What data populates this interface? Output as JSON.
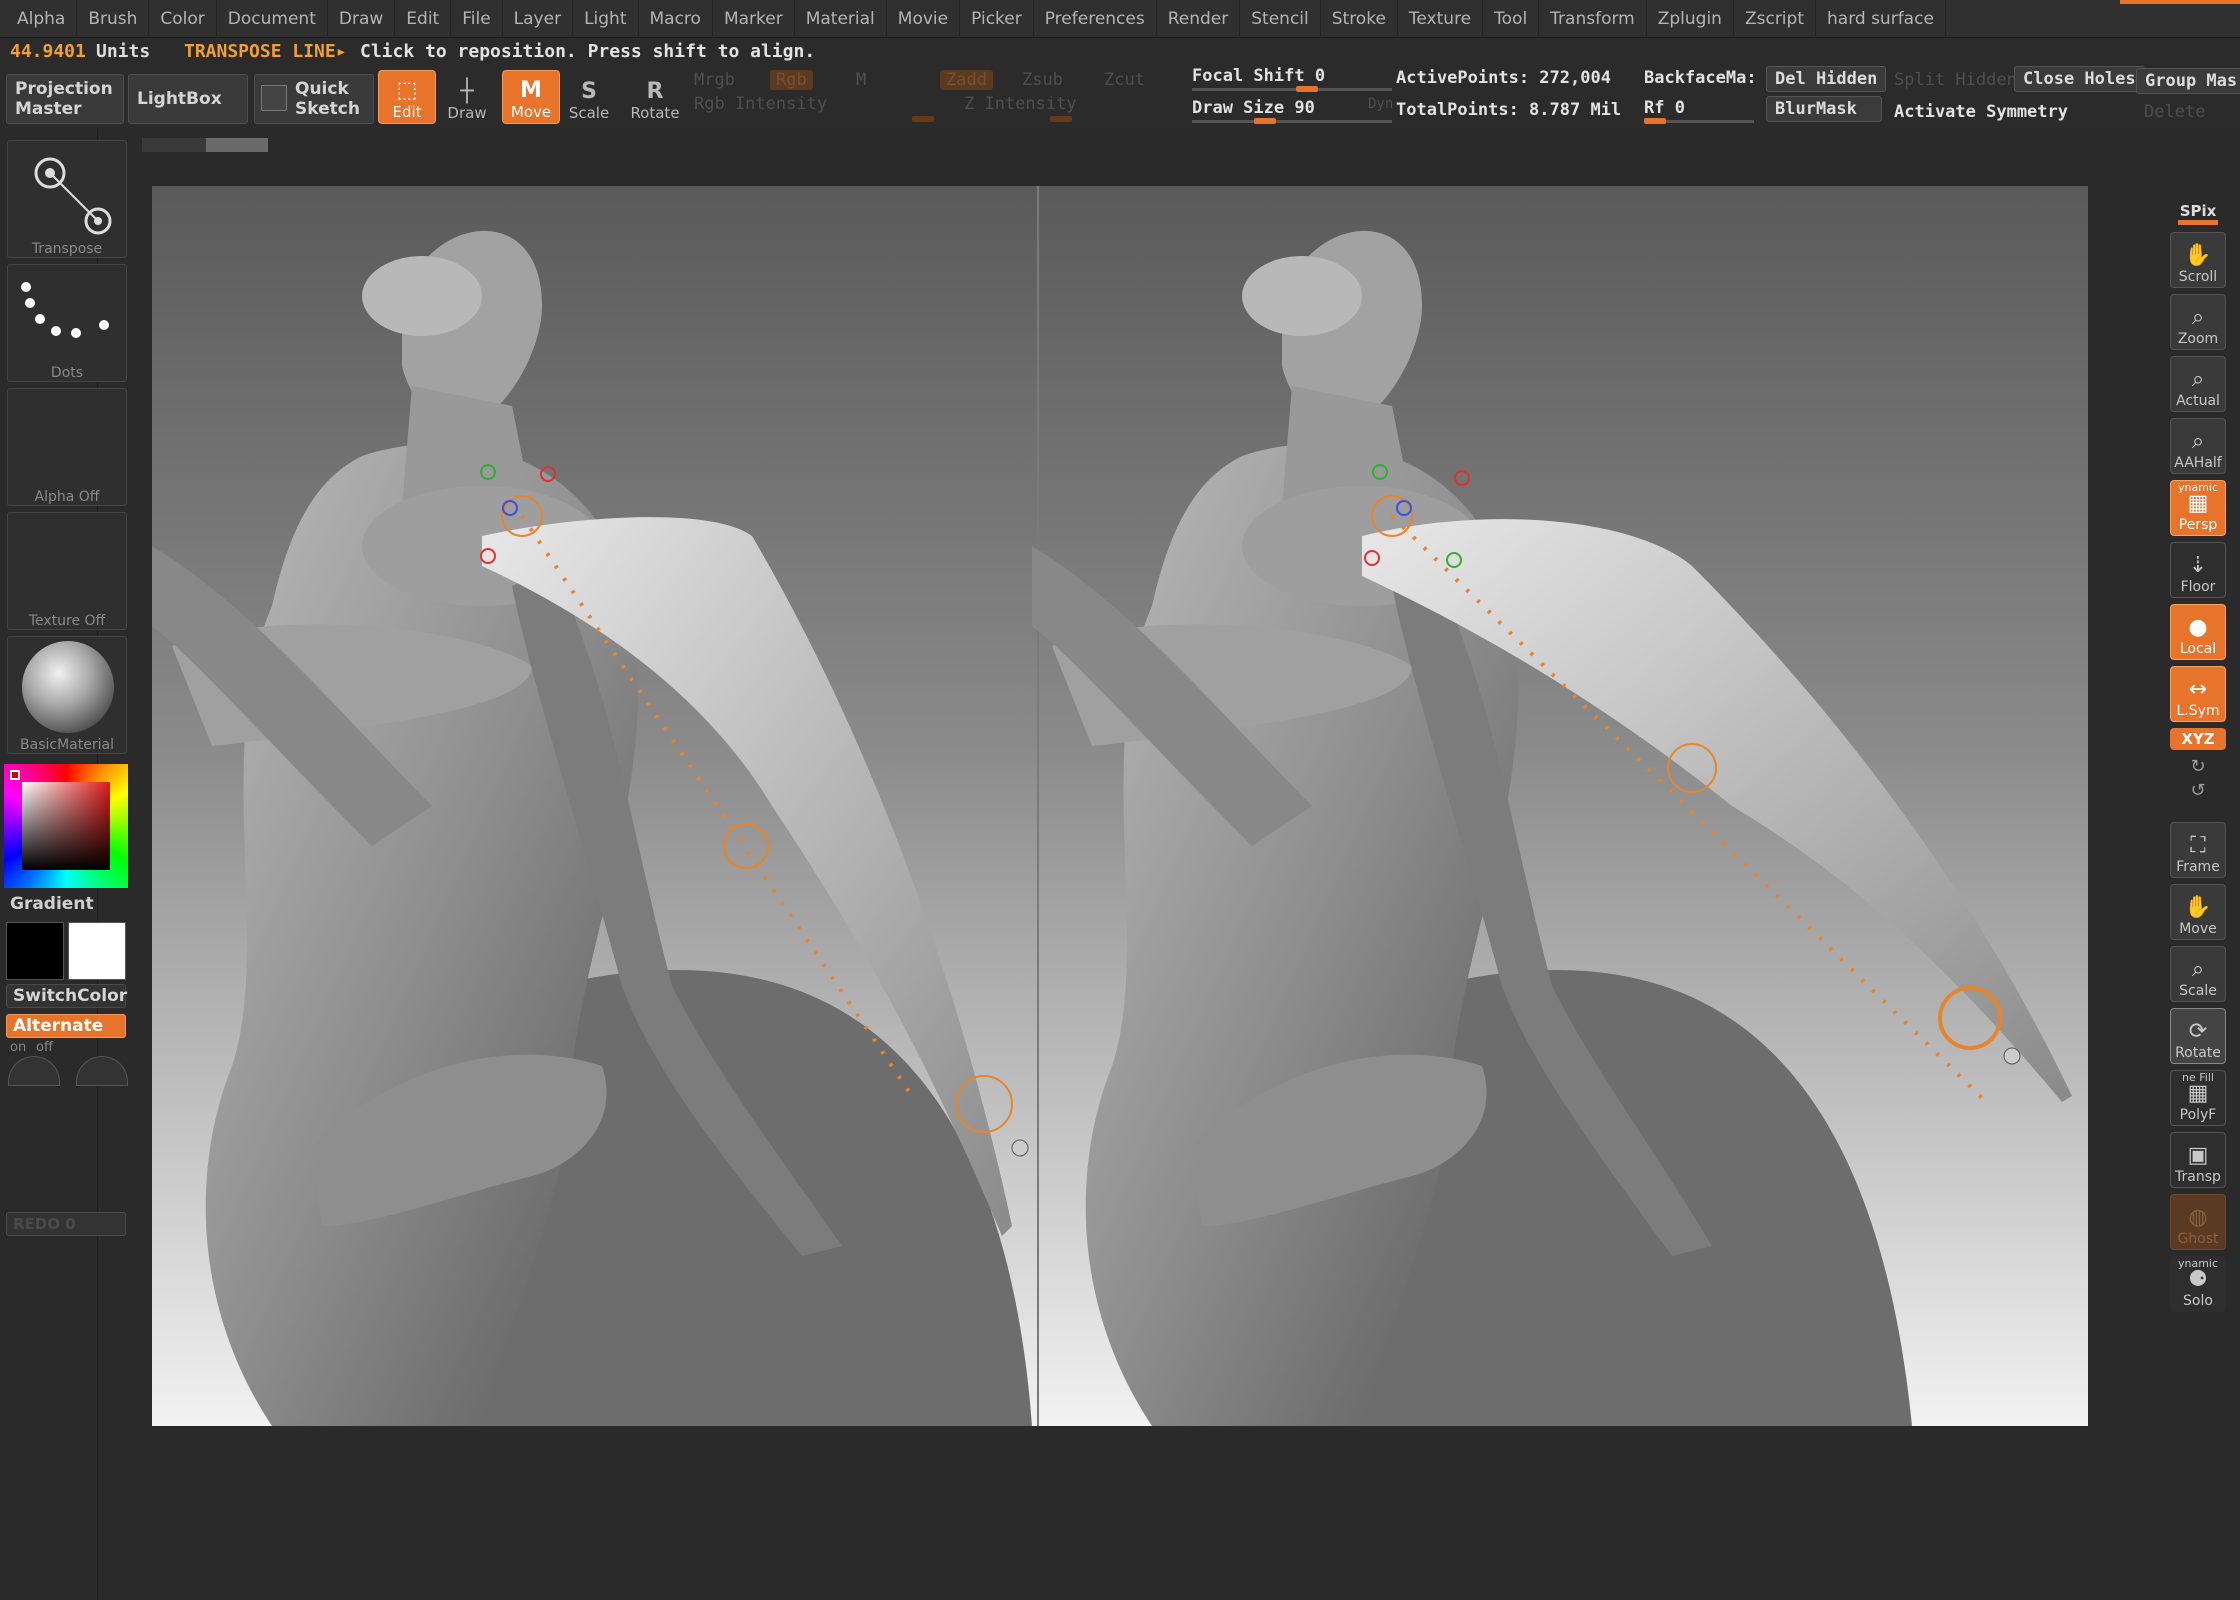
{
  "menu": [
    "Alpha",
    "Brush",
    "Color",
    "Document",
    "Draw",
    "Edit",
    "File",
    "Layer",
    "Light",
    "Macro",
    "Marker",
    "Material",
    "Movie",
    "Picker",
    "Preferences",
    "Render",
    "Stencil",
    "Stroke",
    "Texture",
    "Tool",
    "Transform",
    "Zplugin",
    "Zscript",
    "hard surface"
  ],
  "status": {
    "units_value": "44.9401",
    "units_label": "Units",
    "tool_name": "TRANSPOSE LINE▸",
    "hint": "Click to reposition. Press shift to align."
  },
  "toolbar": {
    "projection_master": "Projection Master",
    "lightbox": "LightBox",
    "quick_sketch": "Quick Sketch",
    "edit": "Edit",
    "draw": "Draw",
    "move": "Move",
    "scale": "Scale",
    "rotate": "Rotate",
    "mrgb": "Mrgb",
    "rgb": "Rgb",
    "m": "M",
    "rgb_intensity": "Rgb Intensity",
    "zadd": "Zadd",
    "zsub": "Zsub",
    "zcut": "Zcut",
    "z_intensity": "Z Intensity",
    "focal_shift": "Focal Shift 0",
    "draw_size": "Draw Size 90",
    "dyn": "Dyn",
    "active_points": "ActivePoints: 272,004",
    "total_points": "TotalPoints: 8.787 Mil",
    "backface": "BackfaceMa:",
    "rf": "Rf 0",
    "del_hidden": "Del Hidden",
    "blurmask": "BlurMask",
    "split_hidden": "Split Hidden",
    "close_holes": "Close Holes",
    "activate_symmetry": "Activate Symmetry",
    "group_mask": "Group Mas",
    "delete": "Delete"
  },
  "left_shelf": {
    "transpose": "Transpose",
    "dots": "Dots",
    "alpha_off": "Alpha Off",
    "texture_off": "Texture Off",
    "basic_material": "BasicMaterial",
    "gradient": "Gradient",
    "switch_color": "SwitchColor",
    "alternate": "Alternate",
    "on": "on",
    "off": "off",
    "redo": "REDO 0"
  },
  "right_shelf": {
    "spix": "SPix",
    "scroll": "Scroll",
    "zoom": "Zoom",
    "actual": "Actual",
    "aahalf": "AAHalf",
    "dynamic": "ynamic",
    "persp": "Persp",
    "floor": "Floor",
    "local": "Local",
    "lsym": "L.Sym",
    "xyz": "XYZ",
    "frame": "Frame",
    "move": "Move",
    "scale": "Scale",
    "rotate": "Rotate",
    "line_fill": "ne Fill",
    "polyf": "PolyF",
    "transp": "Transp",
    "ghost": "Ghost",
    "dynamic2": "ynamic",
    "solo": "Solo"
  },
  "colors": {
    "accent": "#e8742c",
    "panel": "#2a2a2a",
    "button": "#3a3a3a"
  }
}
